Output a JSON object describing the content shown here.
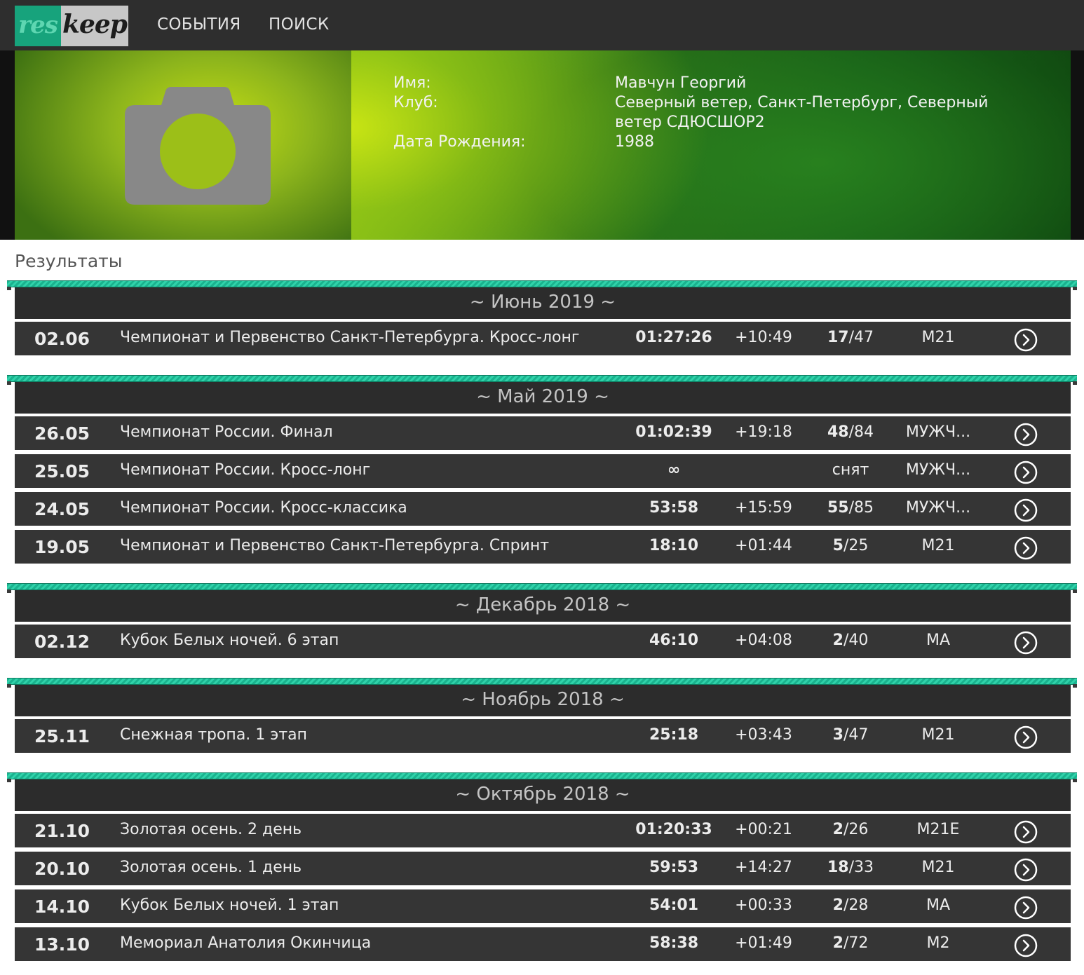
{
  "nav": {
    "logo_res": "res",
    "logo_keep": "keep",
    "events": "СОБЫТИЯ",
    "search": "ПОИСК"
  },
  "profile": {
    "name_label": "Имя:",
    "name_value": "Мавчун Георгий",
    "club_label": "Клуб:",
    "club_value": "Северный ветер, Санкт-Петербург, Северный ветер СДЮСШОР2",
    "birth_label": "Дата Рождения:",
    "birth_value": "1988"
  },
  "results_title": "Результаты",
  "months": [
    {
      "title": "~ Июнь 2019 ~",
      "rows": [
        {
          "date": "02.06",
          "name": "Чемпионат и Первенство Санкт-Петербурга. Кросс-лонг",
          "time": "01:27:26",
          "diff": "+10:49",
          "place": "17",
          "total": "/47",
          "group": "М21"
        }
      ]
    },
    {
      "title": "~ Май 2019 ~",
      "rows": [
        {
          "date": "26.05",
          "name": "Чемпионат России. Финал",
          "time": "01:02:39",
          "diff": "+19:18",
          "place": "48",
          "total": "/84",
          "group": "МУЖЧ..."
        },
        {
          "date": "25.05",
          "name": "Чемпионат России. Кросс-лонг",
          "time": "∞",
          "diff": "",
          "place": "",
          "total": "снят",
          "group": "МУЖЧ..."
        },
        {
          "date": "24.05",
          "name": "Чемпионат России. Кросс-классика",
          "time": "53:58",
          "diff": "+15:59",
          "place": "55",
          "total": "/85",
          "group": "МУЖЧ..."
        },
        {
          "date": "19.05",
          "name": "Чемпионат и Первенство Санкт-Петербурга. Спринт",
          "time": "18:10",
          "diff": "+01:44",
          "place": "5",
          "total": "/25",
          "group": "М21"
        }
      ]
    },
    {
      "title": "~ Декабрь 2018 ~",
      "rows": [
        {
          "date": "02.12",
          "name": "Кубок Белых ночей. 6 этап",
          "time": "46:10",
          "diff": "+04:08",
          "place": "2",
          "total": "/40",
          "group": "МА"
        }
      ]
    },
    {
      "title": "~ Ноябрь 2018 ~",
      "rows": [
        {
          "date": "25.11",
          "name": "Снежная тропа. 1 этап",
          "time": "25:18",
          "diff": "+03:43",
          "place": "3",
          "total": "/47",
          "group": "М21"
        }
      ]
    },
    {
      "title": "~ Октябрь 2018 ~",
      "rows": [
        {
          "date": "21.10",
          "name": "Золотая осень. 2 день",
          "time": "01:20:33",
          "diff": "+00:21",
          "place": "2",
          "total": "/26",
          "group": "М21Е"
        },
        {
          "date": "20.10",
          "name": "Золотая осень. 1 день",
          "time": "59:53",
          "diff": "+14:27",
          "place": "18",
          "total": "/33",
          "group": "М21"
        },
        {
          "date": "14.10",
          "name": "Кубок Белых ночей. 1 этап",
          "time": "54:01",
          "diff": "+00:33",
          "place": "2",
          "total": "/28",
          "group": "МА"
        },
        {
          "date": "13.10",
          "name": "Мемориал Анатолия Окинчица",
          "time": "58:38",
          "diff": "+01:49",
          "place": "2",
          "total": "/72",
          "group": "М2"
        }
      ]
    }
  ],
  "icons": {
    "camera": "camera-icon",
    "arrow": "arrow-right-circle-icon"
  },
  "colors": {
    "accent": "#1ab28e",
    "row_bg": "#353535",
    "topbar_bg": "#2e2e2e"
  }
}
